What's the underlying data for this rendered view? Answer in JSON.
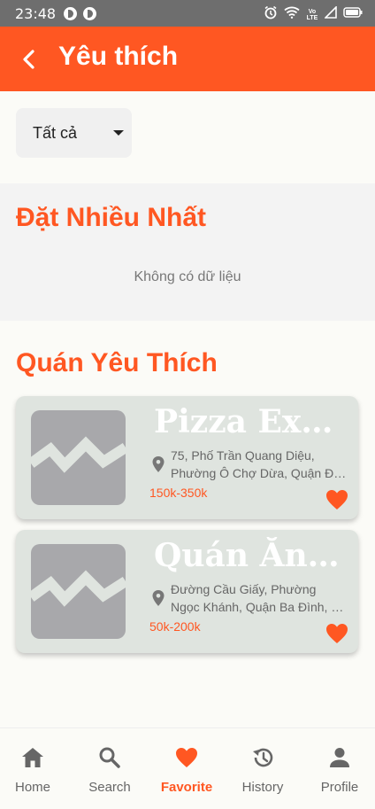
{
  "status_bar": {
    "time": "23:48",
    "icons": [
      "alarm-icon",
      "wifi-icon",
      "volte-icon",
      "signal-icon",
      "battery-icon"
    ],
    "volte_text": "Vo LTE"
  },
  "app_bar": {
    "title": "Yêu thích",
    "back_icon": "arrow-back-icon",
    "background": "#ff5722"
  },
  "filter": {
    "selected": "Tất cả"
  },
  "most_ordered": {
    "title": "Đặt Nhiều Nhất",
    "empty_text": "Không có dữ liệu"
  },
  "favorites": {
    "title": "Quán Yêu Thích",
    "items": [
      {
        "name": "Pizza Express",
        "address_line1": "75, Phố Trần Quang Diệu,",
        "address_line2": "Phường Ô Chợ Dừa, Quận Đống Đa",
        "price": "150k-350k"
      },
      {
        "name": "Quán Ăn Ngon",
        "address_line1": "Đường Cầu Giấy, Phường",
        "address_line2": "Ngọc Khánh, Quận Ba Đình, Hà Nội",
        "price": "50k-200k"
      }
    ]
  },
  "bottom_nav": {
    "items": [
      {
        "label": "Home",
        "icon": "home-icon"
      },
      {
        "label": "Search",
        "icon": "search-icon"
      },
      {
        "label": "Favorite",
        "icon": "heart-icon"
      },
      {
        "label": "History",
        "icon": "history-icon"
      },
      {
        "label": "Profile",
        "icon": "person-icon"
      }
    ],
    "active": "Favorite"
  },
  "colors": {
    "accent": "#ff5722",
    "card": "#dfe4df",
    "placeholder": "#a8a8ab"
  }
}
